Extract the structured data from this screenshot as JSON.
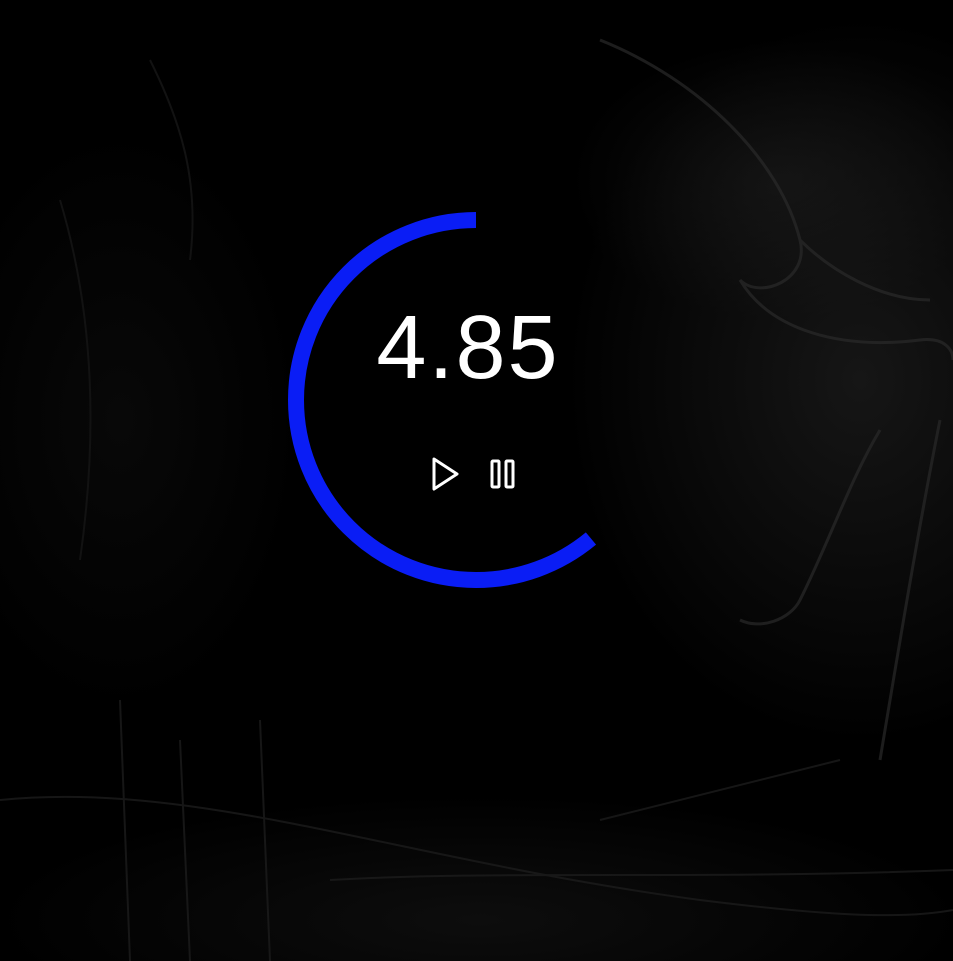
{
  "timer": {
    "value": "4.85",
    "progress": 0.61,
    "ring_color": "#0a1df5"
  },
  "controls": {
    "play_icon": "play-icon",
    "pause_icon": "pause-icon"
  },
  "colors": {
    "background": "#000000",
    "text": "#ffffff"
  }
}
